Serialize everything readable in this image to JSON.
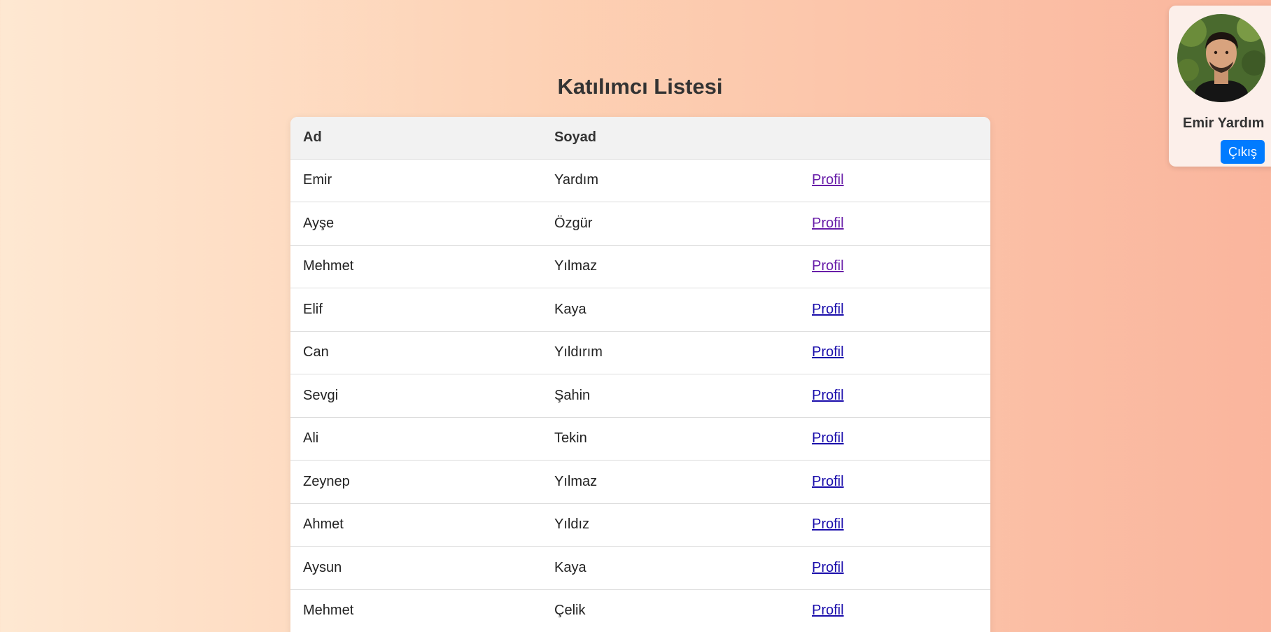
{
  "page": {
    "title": "Katılımcı Listesi"
  },
  "table": {
    "headers": [
      "Ad",
      "Soyad",
      ""
    ],
    "rows": [
      {
        "first": "Emir",
        "last": "Yardım",
        "link": "Profil"
      },
      {
        "first": "Ayşe",
        "last": "Özgür",
        "link": "Profil"
      },
      {
        "first": "Mehmet",
        "last": "Yılmaz",
        "link": "Profil"
      },
      {
        "first": "Elif",
        "last": "Kaya",
        "link": "Profil"
      },
      {
        "first": "Can",
        "last": "Yıldırım",
        "link": "Profil"
      },
      {
        "first": "Sevgi",
        "last": "Şahin",
        "link": "Profil"
      },
      {
        "first": "Ali",
        "last": "Tekin",
        "link": "Profil"
      },
      {
        "first": "Zeynep",
        "last": "Yılmaz",
        "link": "Profil"
      },
      {
        "first": "Ahmet",
        "last": "Yıldız",
        "link": "Profil"
      },
      {
        "first": "Aysun",
        "last": "Kaya",
        "link": "Profil"
      },
      {
        "first": "Mehmet",
        "last": "Çelik",
        "link": "Profil"
      }
    ]
  },
  "user": {
    "name": "Emir Yardım",
    "logout_label": "Çıkış"
  },
  "colors": {
    "link": "#1a0dab",
    "visited_link": "#681da8",
    "button": "#007bff"
  }
}
